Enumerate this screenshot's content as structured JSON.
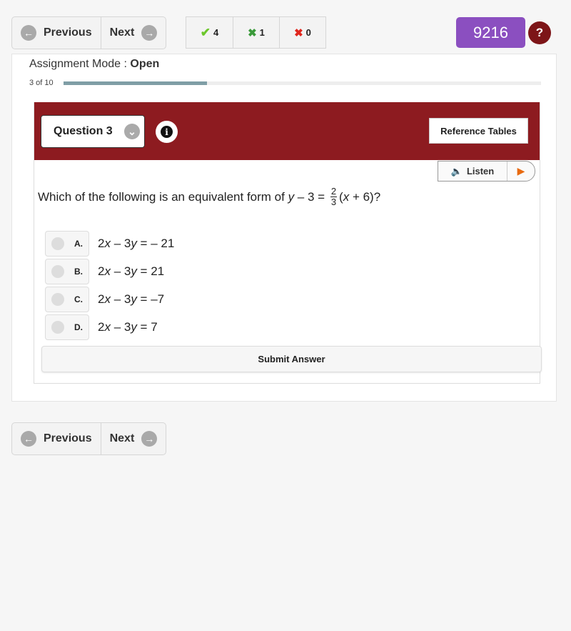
{
  "nav": {
    "previous": "Previous",
    "next": "Next"
  },
  "scores": [
    {
      "icon": "check-icon",
      "color": "#6cc72c",
      "value": "4"
    },
    {
      "icon": "partial-x-icon",
      "color": "#3a9a3a",
      "value": "1"
    },
    {
      "icon": "x-icon",
      "color": "#e0261d",
      "value": "0"
    }
  ],
  "points": "9216",
  "help": "?",
  "mode": {
    "label": "Assignment Mode : ",
    "value": "Open"
  },
  "progress": {
    "label": "3 of 10",
    "fraction": 0.3
  },
  "question": {
    "selector": "Question 3",
    "reference": "Reference Tables",
    "listen": "Listen",
    "prefix": "Which of the following is an equivalent form of ",
    "var_y": "y",
    "mid": " – 3 = ",
    "num": "2",
    "den": "3",
    "open": "(",
    "var_x": "x",
    "tail": " + 6)?"
  },
  "choices": [
    {
      "letter": "A.",
      "a": "2",
      "v1": "x",
      "b": " – 3",
      "v2": "y",
      "c": " = – 21"
    },
    {
      "letter": "B.",
      "a": "2",
      "v1": "x",
      "b": " – 3",
      "v2": "y",
      "c": " = 21"
    },
    {
      "letter": "C.",
      "a": "2",
      "v1": "x",
      "b": " – 3",
      "v2": "y",
      "c": " = –7"
    },
    {
      "letter": "D.",
      "a": "2",
      "v1": "x",
      "b": " – 3",
      "v2": "y",
      "c": " = 7"
    }
  ],
  "submit": "Submit Answer",
  "colors": {
    "header": "#8d1b20",
    "points": "#8b4fc0",
    "progress": "#7f9ea6"
  }
}
